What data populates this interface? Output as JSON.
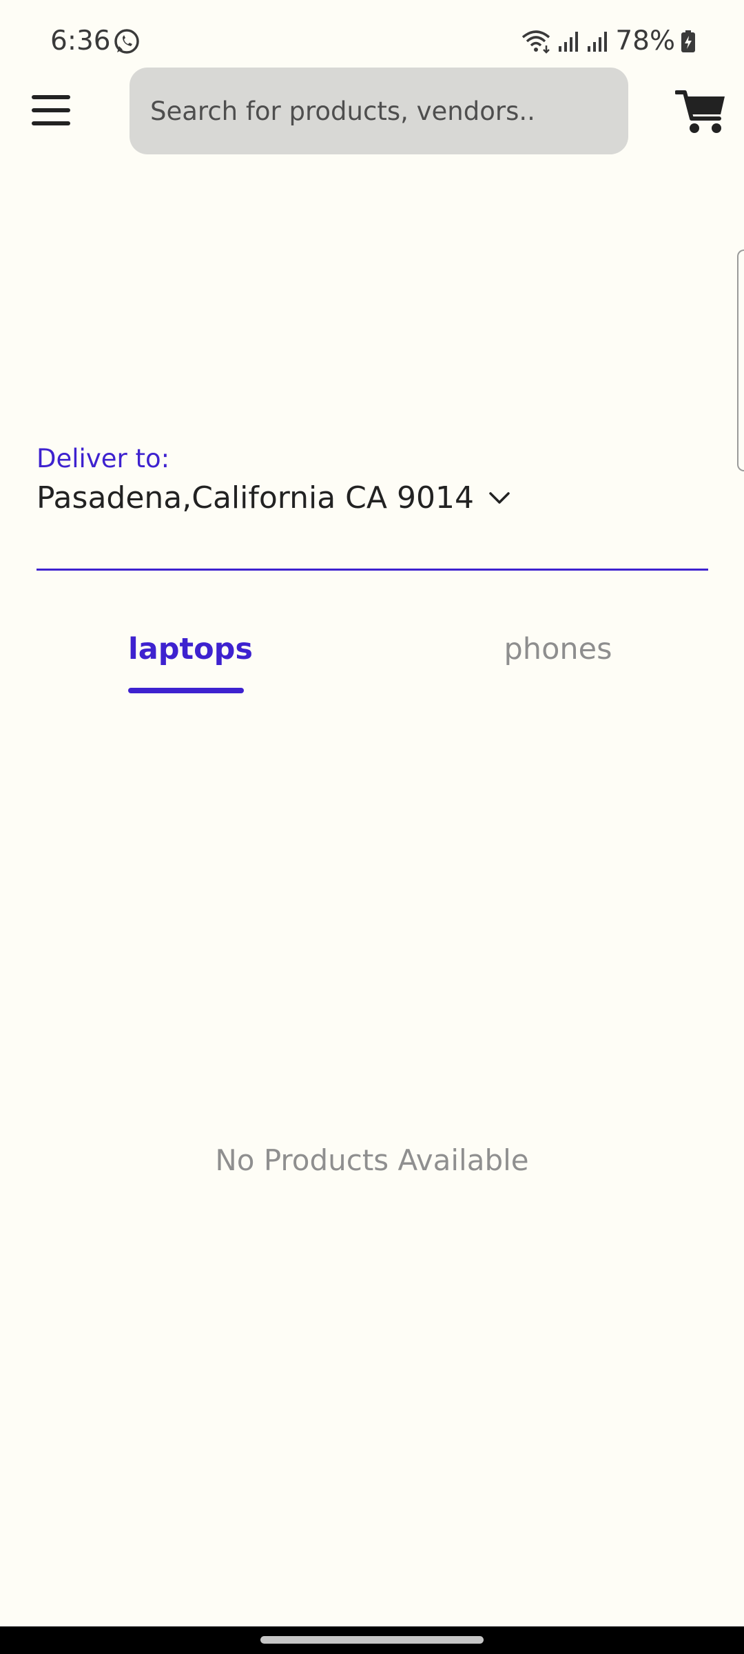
{
  "status_bar": {
    "time": "6:36",
    "battery": "78%",
    "icons": [
      "whatsapp-icon",
      "wifi-icon",
      "signal-icon",
      "signal-icon",
      "battery-charging-icon"
    ]
  },
  "header": {
    "menu_icon": "hamburger-menu-icon",
    "search_placeholder": "Search for products, vendors..",
    "cart_icon": "shopping-cart-icon"
  },
  "delivery": {
    "label": "Deliver to:",
    "address": "Pasadena,California CA 9014"
  },
  "tabs": [
    {
      "label": "laptops",
      "selected": true
    },
    {
      "label": "phones",
      "selected": false
    }
  ],
  "content": {
    "empty_message": "No Products Available"
  },
  "colors": {
    "background": "#FEFDF6",
    "accent": "#3E22CF",
    "search_bg": "#D8D8D5",
    "muted_text": "#8F8F8F"
  }
}
